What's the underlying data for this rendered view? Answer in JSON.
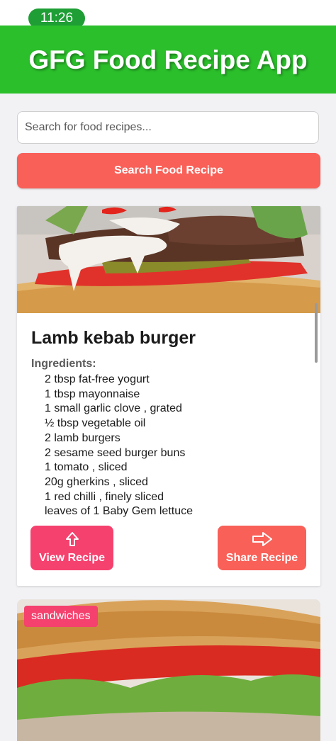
{
  "status_bar": {
    "time": "11:26"
  },
  "header": {
    "title": "GFG Food Recipe App"
  },
  "search": {
    "placeholder": "Search for food recipes...",
    "button_label": "Search Food Recipe"
  },
  "recipe": {
    "title": "Lamb kebab burger",
    "ingredients_label": "Ingredients:",
    "ingredients": [
      "2 tbsp fat-free yogurt",
      "1 tbsp mayonnaise",
      "1 small garlic clove , grated",
      "½ tbsp vegetable oil",
      "2 lamb burgers",
      "2 sesame seed burger buns",
      "1 tomato , sliced",
      "20g gherkins , sliced",
      "1 red chilli , finely sliced",
      "leaves of 1 Baby Gem lettuce"
    ],
    "view_button": "View Recipe",
    "share_button": "Share Recipe"
  },
  "next_recipe": {
    "tag": "sandwiches"
  },
  "colors": {
    "header": "#2bbf2b",
    "search_button": "#f86058",
    "view_button": "#f5416e",
    "share_button": "#f86058",
    "tag": "#f5416e"
  }
}
